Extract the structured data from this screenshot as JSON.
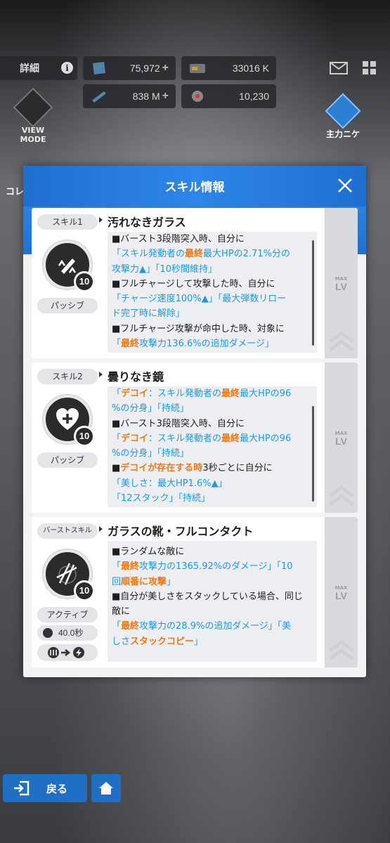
{
  "top": {
    "detail_label": "詳細",
    "info_icon": "i",
    "resources": [
      {
        "icon": "gem-icon",
        "value": "75,972",
        "plus": "+"
      },
      {
        "icon": "credit-card-icon",
        "value": "33016 K",
        "plus": ""
      },
      {
        "icon": "bullet-icon",
        "value": "838 M",
        "plus": "+"
      },
      {
        "icon": "core-icon",
        "value": "10,230",
        "plus": ""
      }
    ],
    "view_mode_label": "VIEW MODE",
    "right_icon_label": "主力ニケ",
    "left_name_partial": "コレ"
  },
  "modal": {
    "title": "スキル情報",
    "skills": [
      {
        "tag": "スキル1",
        "name": "汚れなきガラス",
        "level": "10",
        "type": "パッシブ",
        "icon": "weapon-up-icon",
        "max_label": "MAX",
        "lv_label": "LV"
      },
      {
        "tag": "スキル2",
        "name": "曇りなき鏡",
        "level": "10",
        "type": "パッシブ",
        "icon": "heart-plus-icon",
        "max_label": "MAX",
        "lv_label": "LV"
      },
      {
        "tag": "バーストスキル",
        "name": "ガラスの靴・フルコンタクト",
        "level": "10",
        "type": "アクティブ",
        "cooldown": "40.0秒",
        "icon": "burst-slash-icon",
        "max_label": "MAX",
        "lv_label": "LV"
      }
    ],
    "desc1": {
      "l1": "■バースト3段階突入時、自分に",
      "l2a": "「スキル発動者の",
      "l2b": "最終",
      "l2c": "最大HPの2.71%分の",
      "l3": "攻撃力▲」「10秒間維持」",
      "l4": "■フルチャージして攻撃した時、自分に",
      "l5": "「チャージ速度100%▲」「最大弾数リロー",
      "l6": "ド完了時に解除」",
      "l7": "■フルチャージ攻撃が命中した時、対象に",
      "l8a": "「",
      "l8b": "最終",
      "l8c": "攻撃力136.6%の追加ダメージ」"
    },
    "desc2": {
      "l1a": "「",
      "l1b": "デコイ",
      "l1c": "：スキル発動者の",
      "l1d": "最終",
      "l1e": "最大HPの96",
      "l2": "%の分身」「持続」",
      "l3": "■バースト3段階突入時、自分に",
      "l4a": "「",
      "l4b": "デコイ",
      "l4c": "：スキル発動者の",
      "l4d": "最終",
      "l4e": "最大HPの96",
      "l5": "%の分身」「持続」",
      "l6a": "■",
      "l6b": "デコイが存在する時",
      "l6c": "3秒ごとに自分に",
      "l7": "「美しさ：最大HP1.6%▲」",
      "l8": "「12スタック」「持続」"
    },
    "desc3": {
      "l1": "■ランダムな敵に",
      "l2a": "「",
      "l2b": "最終",
      "l2c": "攻撃力の1365.92%のダメージ」「10",
      "l3a": "回",
      "l3b": "順番に攻撃",
      "l3c": "」",
      "l4": "■自分が美しさをスタックしている場合、同じ",
      "l5": "敵に",
      "l6a": "「",
      "l6b": "最終",
      "l6c": "攻撃力の28.9%の追加ダメージ」「美",
      "l7a": "しさ",
      "l7b": "スタックコピー",
      "l7c": "」"
    }
  },
  "bottom": {
    "back_label": "戻る"
  }
}
